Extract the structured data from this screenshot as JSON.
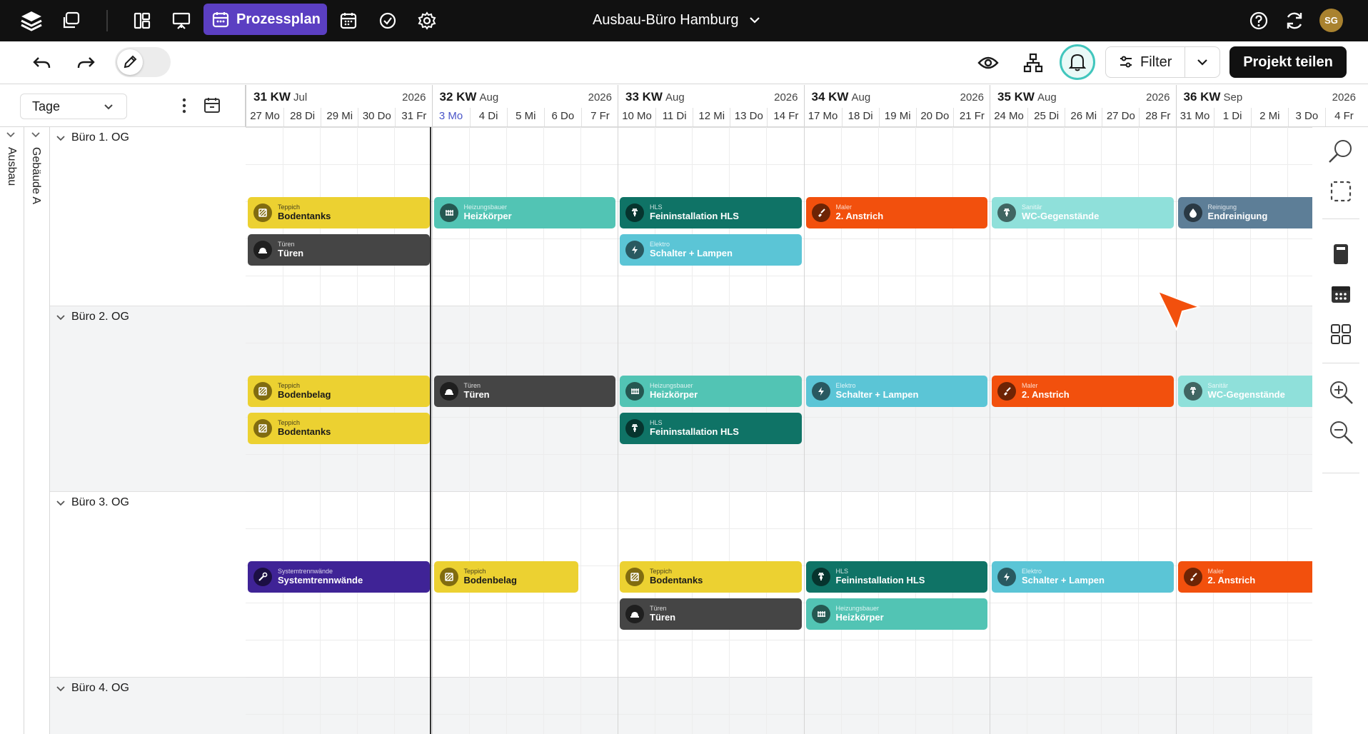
{
  "topbar": {
    "active_tab": "Prozessplan",
    "project_title": "Ausbau-Büro Hamburg",
    "avatar_initials": "SG"
  },
  "toolbar": {
    "filter_label": "Filter",
    "share_label": "Projekt teilen"
  },
  "view": {
    "mode": "Tage"
  },
  "weeks": [
    {
      "kw": "31 KW",
      "month": "Jul",
      "year": "2026",
      "days": [
        "27 Mo",
        "28 Di",
        "29 Mi",
        "30 Do",
        "31 Fr"
      ]
    },
    {
      "kw": "32 KW",
      "month": "Aug",
      "year": "2026",
      "days": [
        "3 Mo",
        "4 Di",
        "5 Mi",
        "6 Do",
        "7 Fr"
      ]
    },
    {
      "kw": "33 KW",
      "month": "Aug",
      "year": "2026",
      "days": [
        "10 Mo",
        "11 Di",
        "12 Mi",
        "13 Do",
        "14 Fr"
      ]
    },
    {
      "kw": "34 KW",
      "month": "Aug",
      "year": "2026",
      "days": [
        "17 Mo",
        "18 Di",
        "19 Mi",
        "20 Do",
        "21 Fr"
      ]
    },
    {
      "kw": "35 KW",
      "month": "Aug",
      "year": "2026",
      "days": [
        "24 Mo",
        "25 Di",
        "26 Mi",
        "27 Do",
        "28 Fr"
      ]
    },
    {
      "kw": "36 KW",
      "month": "Sep",
      "year": "2026",
      "days": [
        "31 Mo",
        "1 Di",
        "2 Mi",
        "3 Do",
        "4 Fr"
      ]
    }
  ],
  "today": "3 Mo",
  "hierarchy": {
    "level1": "Ausbau",
    "level2": "Gebäude A"
  },
  "groups": [
    {
      "label": "Büro 1. OG"
    },
    {
      "label": "Büro 2. OG"
    },
    {
      "label": "Büro 3. OG"
    },
    {
      "label": "Büro 4. OG"
    }
  ],
  "colors": {
    "Teppich": "#ecd131",
    "Heizungsbauer": "#52c4b4",
    "HLS": "#0f7366",
    "Maler": "#f2500d",
    "Sanitär": "#8fe0da",
    "Reinigung": "#5d7e97",
    "Türen": "#454545",
    "Elektro": "#5bc5d6",
    "Systemtrennwände": "#3f2396"
  },
  "tasks": [
    {
      "group": 0,
      "lane": 0,
      "week": 0,
      "span": 1,
      "category": "Teppich",
      "name": "Bodentanks",
      "icon": "tile"
    },
    {
      "group": 0,
      "lane": 1,
      "week": 0,
      "span": 1,
      "category": "Türen",
      "name": "Türen",
      "icon": "door"
    },
    {
      "group": 0,
      "lane": 0,
      "week": 1,
      "span": 1,
      "category": "Heizungsbauer",
      "name": "Heizkörper",
      "icon": "radiator"
    },
    {
      "group": 0,
      "lane": 0,
      "week": 2,
      "span": 1,
      "category": "HLS",
      "name": "Feininstallation HLS",
      "icon": "pipe"
    },
    {
      "group": 0,
      "lane": 1,
      "week": 2,
      "span": 1,
      "category": "Elektro",
      "name": "Schalter + Lampen",
      "icon": "bolt"
    },
    {
      "group": 0,
      "lane": 0,
      "week": 3,
      "span": 1,
      "category": "Maler",
      "name": "2. Anstrich",
      "icon": "brush"
    },
    {
      "group": 0,
      "lane": 0,
      "week": 4,
      "span": 1,
      "category": "Sanitär",
      "name": "WC-Gegenstände",
      "icon": "pipe"
    },
    {
      "group": 0,
      "lane": 0,
      "week": 5,
      "span": 1,
      "category": "Reinigung",
      "name": "Endreinigung",
      "icon": "drop"
    },
    {
      "group": 1,
      "lane": 0,
      "week": 0,
      "span": 1,
      "category": "Teppich",
      "name": "Bodenbelag",
      "icon": "tile"
    },
    {
      "group": 1,
      "lane": 1,
      "week": 0,
      "span": 1,
      "category": "Teppich",
      "name": "Bodentanks",
      "icon": "tile"
    },
    {
      "group": 1,
      "lane": 0,
      "week": 1,
      "span": 1,
      "category": "Türen",
      "name": "Türen",
      "icon": "door"
    },
    {
      "group": 1,
      "lane": 0,
      "week": 2,
      "span": 1,
      "category": "Heizungsbauer",
      "name": "Heizkörper",
      "icon": "radiator"
    },
    {
      "group": 1,
      "lane": 1,
      "week": 2,
      "span": 1,
      "category": "HLS",
      "name": "Feininstallation HLS",
      "icon": "pipe"
    },
    {
      "group": 1,
      "lane": 0,
      "week": 3,
      "span": 1,
      "category": "Elektro",
      "name": "Schalter + Lampen",
      "icon": "bolt"
    },
    {
      "group": 1,
      "lane": 0,
      "week": 4,
      "span": 1,
      "category": "Maler",
      "name": "2. Anstrich",
      "icon": "brush"
    },
    {
      "group": 1,
      "lane": 0,
      "week": 5,
      "span": 1,
      "category": "Sanitär",
      "name": "WC-Gegenstände",
      "icon": "pipe"
    },
    {
      "group": 2,
      "lane": 0,
      "week": 0,
      "span": 1,
      "category": "Systemtrennwände",
      "name": "Systemtrennwände",
      "icon": "wrench"
    },
    {
      "group": 2,
      "lane": 0,
      "week": 1,
      "span": 0.8,
      "category": "Teppich",
      "name": "Bodenbelag",
      "icon": "tile"
    },
    {
      "group": 2,
      "lane": 0,
      "week": 2,
      "span": 1,
      "category": "Teppich",
      "name": "Bodentanks",
      "icon": "tile"
    },
    {
      "group": 2,
      "lane": 1,
      "week": 2,
      "span": 1,
      "category": "Türen",
      "name": "Türen",
      "icon": "door"
    },
    {
      "group": 2,
      "lane": 0,
      "week": 3,
      "span": 1,
      "category": "HLS",
      "name": "Feininstallation HLS",
      "icon": "pipe"
    },
    {
      "group": 2,
      "lane": 1,
      "week": 3,
      "span": 1,
      "category": "Heizungsbauer",
      "name": "Heizkörper",
      "icon": "radiator"
    },
    {
      "group": 2,
      "lane": 0,
      "week": 4,
      "span": 1,
      "category": "Elektro",
      "name": "Schalter + Lampen",
      "icon": "bolt"
    },
    {
      "group": 2,
      "lane": 0,
      "week": 5,
      "span": 1,
      "category": "Maler",
      "name": "2. Anstrich",
      "icon": "brush"
    }
  ]
}
